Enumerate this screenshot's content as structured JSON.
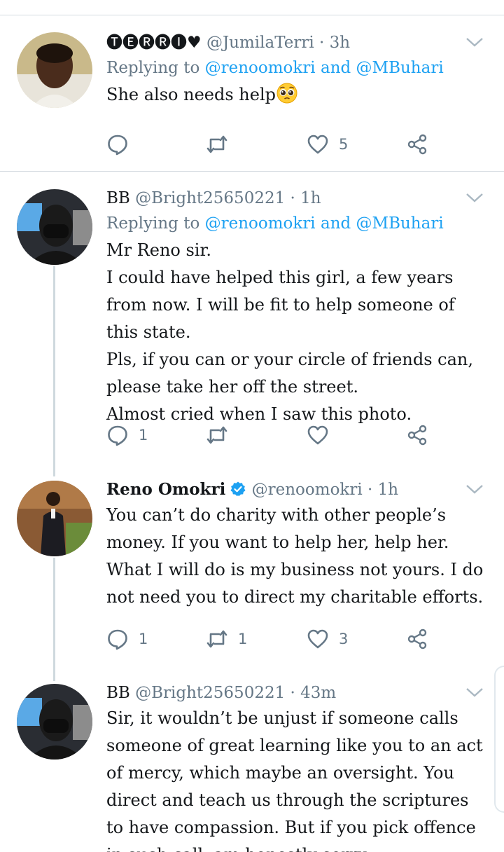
{
  "colors": {
    "accent": "#1da1f2",
    "muted": "#657786",
    "text": "#14171a",
    "divider": "#d5dbe0",
    "verified": "#1da1f2"
  },
  "tweets": [
    {
      "display_name": "🅣🅔🅡🅡🅘♥",
      "handle": "@JumilaTerri",
      "time": "· 3h",
      "replying_prefix": "Replying to",
      "replying_to_1": "@renoomokri",
      "replying_and": "and",
      "replying_to_2": "@MBuhari",
      "text": "She also needs help",
      "emoji": "pleading-face-emoji",
      "reply_count": "",
      "retweet_count": "",
      "like_count": "5"
    },
    {
      "display_name": "BB",
      "handle": "@Bright25650221",
      "time": "· 1h",
      "replying_prefix": "Replying to",
      "replying_to_1": "@renoomokri",
      "replying_and": "and",
      "replying_to_2": "@MBuhari",
      "text": "Mr Reno sir.\nI could have helped this girl, a few years from now. I will be fit to help someone of this state.\nPls, if you can or your circle of friends can, please take her off the street.\nAlmost cried when I saw this photo.",
      "reply_count": "1",
      "retweet_count": "",
      "like_count": ""
    },
    {
      "display_name": "Reno Omokri",
      "handle": "@renoomokri",
      "time": "· 1h",
      "verified_icon": "verified-badge-icon",
      "text": "You can’t do charity with other people’s money. If you want to help her, help her. What I will do is my business not yours. I do not need you to direct my charitable efforts.",
      "reply_count": "1",
      "retweet_count": "1",
      "like_count": "3"
    },
    {
      "display_name": "BB",
      "handle": "@Bright25650221",
      "time": "· 43m",
      "text": "Sir, it wouldn’t be unjust if someone calls someone of great learning like you to an act of mercy, which maybe an oversight. You direct and teach us through the scriptures to have compassion. But if you pick offence in such call, am honestly sorry."
    }
  ]
}
